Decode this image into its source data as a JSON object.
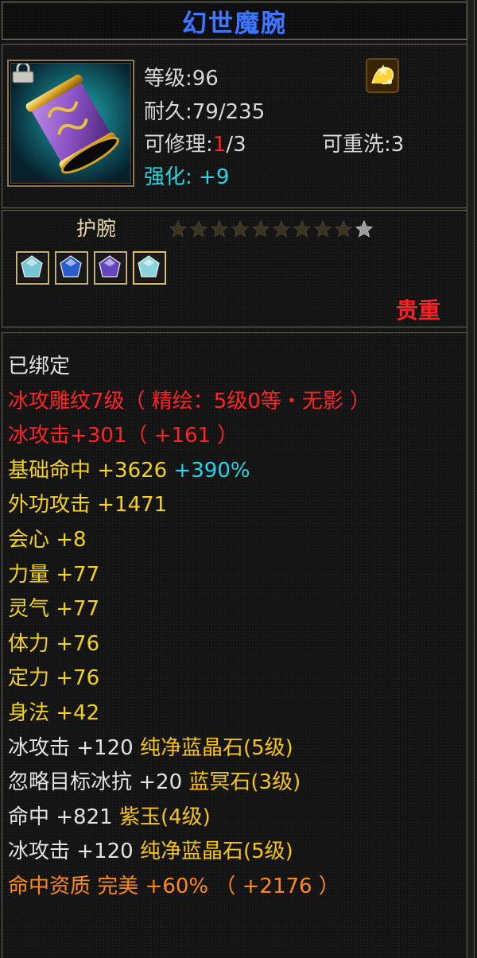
{
  "title": "幻世魔腕",
  "item": {
    "icon": "bracer-item-icon",
    "bound_icon": "lock-icon",
    "level_label": "等级:",
    "level_value": "96",
    "durability_label": "耐久:",
    "durability_value": "79/235",
    "repair_label": "可修理:",
    "repair_used": "1",
    "repair_total": "/3",
    "reroll_label": "可重洗:",
    "reroll_value": "3",
    "strength_label": "强化:",
    "strength_value": "+9",
    "seal_icon": "gold-seal-icon"
  },
  "type_label": "护腕",
  "stars": {
    "total": 10,
    "filled": 0
  },
  "gems": [
    {
      "icon": "gem-icon-diamond",
      "color": "#7ad0e0"
    },
    {
      "icon": "gem-icon-blue-crystal",
      "color": "#2a60d8"
    },
    {
      "icon": "gem-icon-purple",
      "color": "#6a48c8"
    },
    {
      "icon": "gem-icon-diamond-gold",
      "color": "#8fe0e8"
    }
  ],
  "quality": "贵重",
  "attributes": [
    {
      "parts": [
        {
          "text": "已绑定",
          "color": "white"
        }
      ]
    },
    {
      "parts": [
        {
          "text": "冰攻雕纹7级（ 精绘：5级0等・无影 ）",
          "color": "red"
        }
      ]
    },
    {
      "parts": [
        {
          "text": "冰攻击+301（ +161 ）",
          "color": "red"
        }
      ]
    },
    {
      "parts": [
        {
          "text": "基础命中 +3626 ",
          "color": "yellow"
        },
        {
          "text": "+390%",
          "color": "cyan"
        }
      ]
    },
    {
      "parts": [
        {
          "text": "外功攻击 +1471",
          "color": "yellow"
        }
      ]
    },
    {
      "parts": [
        {
          "text": "会心 +8",
          "color": "yellow"
        }
      ]
    },
    {
      "parts": [
        {
          "text": "力量 +77",
          "color": "yellow"
        }
      ]
    },
    {
      "parts": [
        {
          "text": "灵气 +77",
          "color": "yellow"
        }
      ]
    },
    {
      "parts": [
        {
          "text": "体力 +76",
          "color": "yellow"
        }
      ]
    },
    {
      "parts": [
        {
          "text": "定力 +76",
          "color": "yellow"
        }
      ]
    },
    {
      "parts": [
        {
          "text": "身法 +42",
          "color": "yellow"
        }
      ]
    },
    {
      "parts": [
        {
          "text": "冰攻击 +120 ",
          "color": "white"
        },
        {
          "text": "纯净蓝晶石(5级)",
          "color": "gold"
        }
      ]
    },
    {
      "parts": [
        {
          "text": "忽略目标冰抗 +20 ",
          "color": "white"
        },
        {
          "text": "蓝冥石(3级)",
          "color": "gold"
        }
      ]
    },
    {
      "parts": [
        {
          "text": "命中 +821 ",
          "color": "white"
        },
        {
          "text": "紫玉(4级)",
          "color": "gold"
        }
      ]
    },
    {
      "parts": [
        {
          "text": "冰攻击 +120 ",
          "color": "white"
        },
        {
          "text": "纯净蓝晶石(5级)",
          "color": "gold"
        }
      ]
    },
    {
      "parts": [
        {
          "text": "命中资质 完美 +60% （ +2176 ）",
          "color": "orange"
        }
      ]
    }
  ],
  "colors": {
    "title": "#3f78ff",
    "red": "#ff2424",
    "yellow": "#f3d21a",
    "cyan": "#24d6e8",
    "orange": "#ff8a16",
    "gold": "#f6c414",
    "white": "#e2e2e2"
  }
}
